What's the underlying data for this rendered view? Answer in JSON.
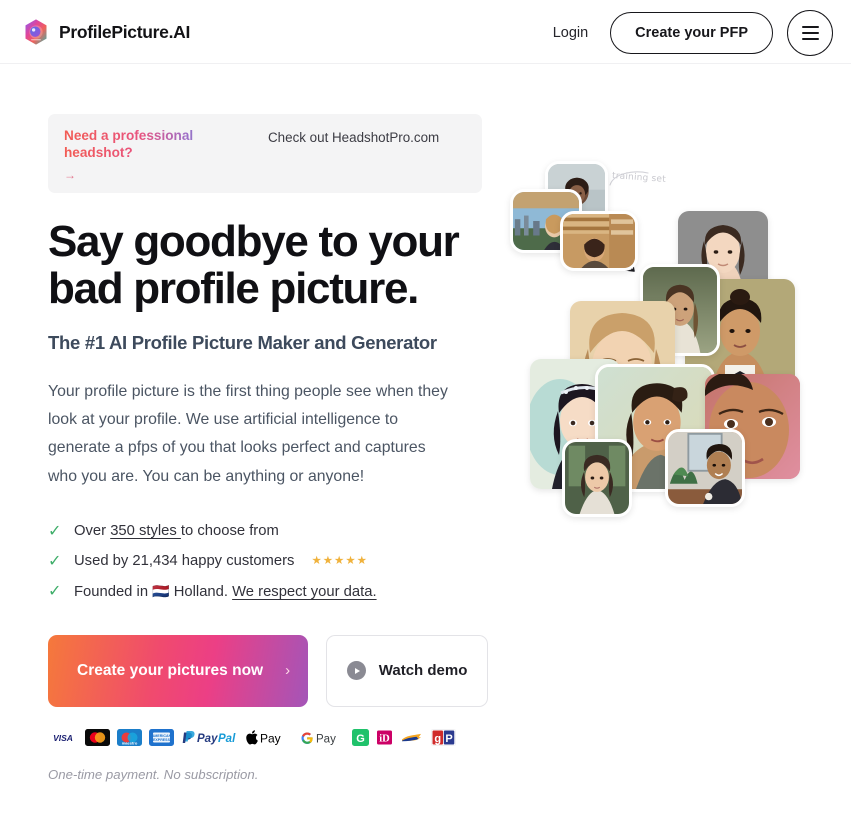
{
  "header": {
    "brand_name": "ProfilePicture.AI",
    "brand_logo_icon": "profilepicture-logo-icon",
    "login_label": "Login",
    "cta_label": "Create your PFP",
    "menu_icon": "hamburger-menu-icon"
  },
  "banner": {
    "headline": "Need a professional headshot?",
    "arrow": "→",
    "body": "Check out HeadshotPro.com"
  },
  "hero": {
    "headline": "Say goodbye to your bad profile picture.",
    "subheadline": "The #1 AI Profile Picture Maker and Generator",
    "body": "Your profile picture is the first thing people see when they look at your profile. We use artificial intelligence to generate a pfps of you that looks perfect and captures who you are. You can be anything or anyone!"
  },
  "features": [
    {
      "check_icon": "check-icon",
      "prefix": "Over ",
      "link": "350 styles ",
      "suffix": "to choose from",
      "stars": "",
      "flag": ""
    },
    {
      "check_icon": "check-icon",
      "prefix": "Used by 21,434 happy customers",
      "link": "",
      "suffix": "",
      "stars": "★★★★★",
      "flag": ""
    },
    {
      "check_icon": "check-icon",
      "prefix": "Founded in ",
      "flag": "🇳🇱",
      "mid": " Holland. ",
      "link": "We respect your data.",
      "suffix": "",
      "stars": ""
    }
  ],
  "cta": {
    "primary_label": "Create your pictures now",
    "primary_chevron": "›",
    "secondary_label": "Watch demo",
    "play_icon": "play-circle-icon"
  },
  "payments": {
    "methods": [
      "visa-icon",
      "mastercard-icon",
      "maestro-icon",
      "amex-icon",
      "paypal-icon",
      "apple-pay-icon",
      "google-pay-icon",
      "giropay-icon",
      "ideal-icon",
      "sofort-icon",
      "przelewy24-icon"
    ],
    "note": "One-time payment. No subscription."
  },
  "collage": {
    "annotation": "training set",
    "annotation_arc_icon": "curved-arc-icon",
    "annotation_arrow_icon": "curved-arrow-down-icon",
    "tiles": [
      {
        "name": "training-photo-1"
      },
      {
        "name": "training-photo-2"
      },
      {
        "name": "training-photo-3"
      },
      {
        "name": "generated-pfp-1"
      },
      {
        "name": "generated-pfp-2"
      },
      {
        "name": "generated-pfp-3"
      },
      {
        "name": "generated-pfp-4"
      },
      {
        "name": "generated-pfp-5"
      },
      {
        "name": "generated-pfp-6"
      },
      {
        "name": "generated-pfp-7"
      },
      {
        "name": "generated-pfp-8"
      },
      {
        "name": "generated-pfp-9"
      }
    ]
  },
  "colors": {
    "accent_orange": "#f5793b",
    "accent_pink": "#ec3f85",
    "accent_purple": "#a455b8",
    "check_green": "#3fae6a",
    "star_gold": "#f0b23c",
    "text_dark": "#101014",
    "text_body": "#4b5563"
  }
}
